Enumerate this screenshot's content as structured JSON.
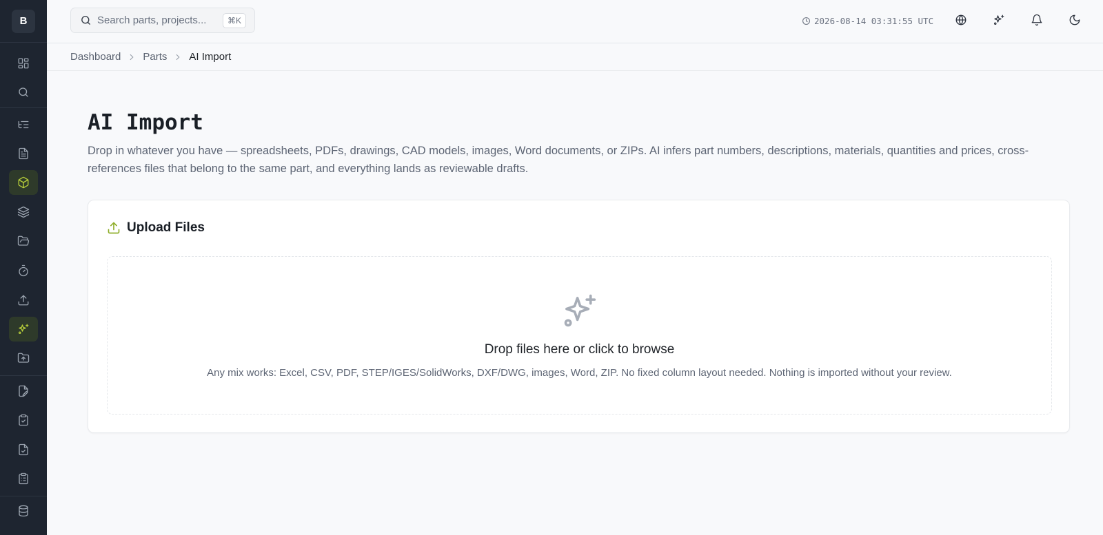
{
  "app": {
    "logo_letter": "B"
  },
  "sidebar": {
    "items": [
      {
        "name": "dashboard",
        "icon": "grid-icon"
      },
      {
        "name": "search",
        "icon": "search-icon"
      },
      {
        "name": "tree",
        "icon": "list-tree-icon"
      },
      {
        "name": "documents",
        "icon": "file-text-icon"
      },
      {
        "name": "parts",
        "icon": "cube-icon",
        "state": "highlighted"
      },
      {
        "name": "layers",
        "icon": "layers-icon"
      },
      {
        "name": "folders",
        "icon": "folder-open-icon"
      },
      {
        "name": "timer",
        "icon": "timer-icon"
      },
      {
        "name": "upload",
        "icon": "upload-icon"
      },
      {
        "name": "ai-import",
        "icon": "sparkles-icon",
        "state": "active"
      },
      {
        "name": "folder-upload",
        "icon": "folder-up-icon"
      },
      {
        "name": "drawings",
        "icon": "file-pen-icon"
      },
      {
        "name": "clipboard",
        "icon": "clipboard-icon"
      },
      {
        "name": "file-check",
        "icon": "file-check-icon"
      },
      {
        "name": "clipboard-list",
        "icon": "clipboard-list-icon"
      },
      {
        "name": "database",
        "icon": "database-icon"
      }
    ]
  },
  "topbar": {
    "search_placeholder": "Search parts, projects...",
    "shortcut": "⌘K",
    "clock": "2026-08-14 03:31:55 UTC",
    "icons": [
      "globe-icon",
      "sparkles-icon",
      "bell-icon",
      "moon-icon"
    ]
  },
  "breadcrumb": {
    "items": [
      "Dashboard",
      "Parts",
      "AI Import"
    ]
  },
  "page": {
    "title": "AI Import",
    "description": "Drop in whatever you have — spreadsheets, PDFs, drawings, CAD models, images, Word documents, or ZIPs. AI infers part numbers, descriptions, materials, quantities and prices, cross-references files that belong to the same part, and everything lands as reviewable drafts."
  },
  "upload": {
    "title": "Upload Files",
    "drop_title": "Drop files here or click to browse",
    "drop_hint": "Any mix works: Excel, CSV, PDF, STEP/IGES/SolidWorks, DXF/DWG, images, Word, ZIP. No fixed column layout needed. Nothing is imported without your review."
  },
  "colors": {
    "sidebar_bg": "#1e2530",
    "accent": "#b8cf3a",
    "upload_icon": "#8fae2a"
  }
}
